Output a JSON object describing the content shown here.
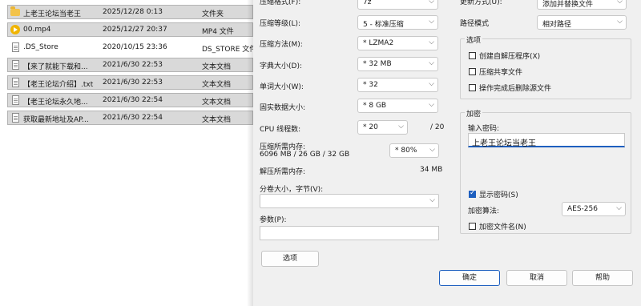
{
  "files": [
    {
      "name": "上老王论坛当老王",
      "date": "2025/12/28 0:13",
      "type": "文件夹",
      "icon": "folder-icon"
    },
    {
      "name": "00.mp4",
      "date": "2025/12/27 20:37",
      "type": "MP4 文件",
      "icon": "media-icon"
    },
    {
      "name": ".DS_Store",
      "date": "2020/10/15 23:36",
      "type": "DS_STORE 文件",
      "icon": "file-icon"
    },
    {
      "name": "【来了就能下载和...",
      "date": "2021/6/30 22:53",
      "type": "文本文档",
      "icon": "text-document-icon"
    },
    {
      "name": "【老王论坛介绍】.txt",
      "date": "2021/6/30 22:53",
      "type": "文本文档",
      "icon": "text-document-icon"
    },
    {
      "name": "【老王论坛永久地...",
      "date": "2021/6/30 22:54",
      "type": "文本文档",
      "icon": "text-document-icon"
    },
    {
      "name": "获取最新地址及AP...",
      "date": "2021/6/30 22:54",
      "type": "文本文档",
      "icon": "text-document-icon"
    }
  ],
  "dialog": {
    "archive_format": {
      "label": "压缩格式(F):",
      "value": "7z"
    },
    "compression_level": {
      "label": "压缩等级(L):",
      "value": "5 - 标准压缩"
    },
    "compression_method": {
      "label": "压缩方法(M):",
      "value": "* LZMA2"
    },
    "dictionary_size": {
      "label": "字典大小(D):",
      "value": "* 32 MB"
    },
    "word_size": {
      "label": "单词大小(W):",
      "value": "* 32"
    },
    "solid_block_size": {
      "label": "固实数据大小:",
      "value": "* 8 GB"
    },
    "cpu_threads": {
      "label": "CPU 线程数:",
      "value": "* 20",
      "total": "/ 20"
    },
    "memory_compress": {
      "label": "压缩所需内存:",
      "detail": "6096 MB / 26 GB / 32 GB",
      "value": "* 80%"
    },
    "memory_decompress": {
      "label": "解压所需内存:",
      "value": "34 MB"
    },
    "split_volumes": {
      "label": "分卷大小，字节(V):",
      "value": ""
    },
    "parameters": {
      "label": "参数(P):",
      "value": ""
    },
    "options_button": "选项",
    "update_mode": {
      "label": "更新方式(U):",
      "value": "添加并替换文件"
    },
    "path_mode": {
      "label": "路径模式",
      "value": "相对路径"
    },
    "options_group": {
      "title": "选项",
      "sfx": {
        "label": "创建自解压程序(X)",
        "checked": false
      },
      "shared": {
        "label": "压缩共享文件",
        "checked": false
      },
      "delete_after": {
        "label": "操作完成后删除源文件",
        "checked": false
      }
    },
    "encryption_group": {
      "title": "加密",
      "password_label": "输入密码:",
      "password_value": "上老王论坛当老王",
      "show_password": {
        "label": "显示密码(S)",
        "checked": true
      },
      "method_label": "加密算法:",
      "method_value": "AES-256",
      "encrypt_names": {
        "label": "加密文件名(N)",
        "checked": false
      }
    },
    "buttons": {
      "ok": "确定",
      "cancel": "取消",
      "help": "帮助"
    }
  }
}
